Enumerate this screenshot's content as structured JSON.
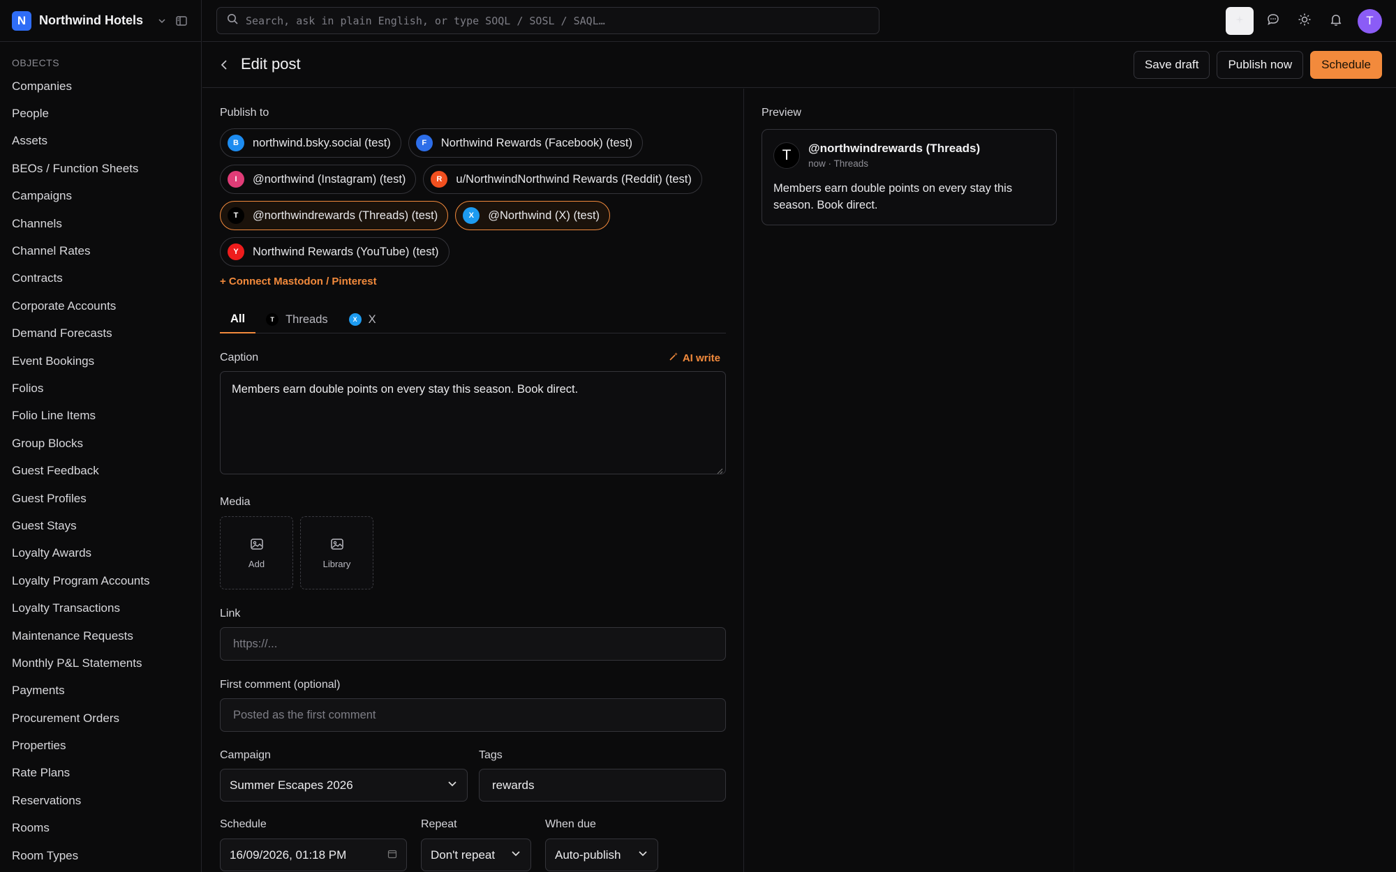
{
  "workspace": {
    "logo_letter": "N",
    "name": "Northwind Hotels"
  },
  "sidebar": {
    "section_label": "OBJECTS",
    "items": [
      "Companies",
      "People",
      "Assets",
      "BEOs / Function Sheets",
      "Campaigns",
      "Channels",
      "Channel Rates",
      "Contracts",
      "Corporate Accounts",
      "Demand Forecasts",
      "Event Bookings",
      "Folios",
      "Folio Line Items",
      "Group Blocks",
      "Guest Feedback",
      "Guest Profiles",
      "Guest Stays",
      "Loyalty Awards",
      "Loyalty Program Accounts",
      "Loyalty Transactions",
      "Maintenance Requests",
      "Monthly P&L Statements",
      "Payments",
      "Procurement Orders",
      "Properties",
      "Rate Plans",
      "Reservations",
      "Rooms",
      "Room Types"
    ]
  },
  "search": {
    "placeholder": "Search, ask in plain English, or type SOQL / SOSL / SAQL…"
  },
  "user": {
    "avatar_letter": "T",
    "avatar_color": "#8b5cf6"
  },
  "header": {
    "title": "Edit post",
    "save_draft": "Save draft",
    "publish_now": "Publish now",
    "schedule": "Schedule"
  },
  "form": {
    "publish_to_label": "Publish to",
    "channels": [
      {
        "letter": "B",
        "label": "northwind.bsky.social (test)",
        "color": "#1d8cf0",
        "selected": false
      },
      {
        "letter": "F",
        "label": "Northwind Rewards (Facebook) (test)",
        "color": "#2d6ee9",
        "selected": false
      },
      {
        "letter": "I",
        "label": "@northwind (Instagram) (test)",
        "color": "#e03c77",
        "selected": false
      },
      {
        "letter": "R",
        "label": "u/NorthwindNorthwind Rewards (Reddit) (test)",
        "color": "#f2501f",
        "selected": false
      },
      {
        "letter": "T",
        "label": "@northwindrewards (Threads) (test)",
        "color": "#000000",
        "selected": true
      },
      {
        "letter": "X",
        "label": "@Northwind (X) (test)",
        "color": "#1d9bf0",
        "selected": true
      },
      {
        "letter": "Y",
        "label": "Northwind Rewards (YouTube) (test)",
        "color": "#ee1c1c",
        "selected": false
      }
    ],
    "connect_link": "+ Connect Mastodon / Pinterest",
    "tabs": [
      {
        "label": "All",
        "letter": "",
        "color": ""
      },
      {
        "label": "Threads",
        "letter": "T",
        "color": "#000000"
      },
      {
        "label": "X",
        "letter": "X",
        "color": "#1d9bf0"
      }
    ],
    "caption_label": "Caption",
    "ai_write": "AI write",
    "caption_value": "Members earn double points on every stay this season. Book direct.",
    "media_label": "Media",
    "media_add": "Add",
    "media_library": "Library",
    "link_label": "Link",
    "link_placeholder": "https://...",
    "first_comment_label": "First comment (optional)",
    "first_comment_placeholder": "Posted as the first comment",
    "campaign_label": "Campaign",
    "campaign_value": "Summer Escapes 2026",
    "tags_label": "Tags",
    "tags_value": "rewards",
    "schedule_label": "Schedule",
    "schedule_value": "16/09/2026, 01:18  PM",
    "repeat_label": "Repeat",
    "repeat_value": "Don't repeat",
    "when_due_label": "When due",
    "when_due_value": "Auto-publish"
  },
  "preview": {
    "label": "Preview",
    "avatar_letter": "T",
    "name": "@northwindrewards (Threads)",
    "meta": "now · Threads",
    "body": "Members earn double points on every stay this season. Book direct."
  },
  "colors": {
    "accent": "#f28a3c",
    "background": "#0b0b0c"
  }
}
